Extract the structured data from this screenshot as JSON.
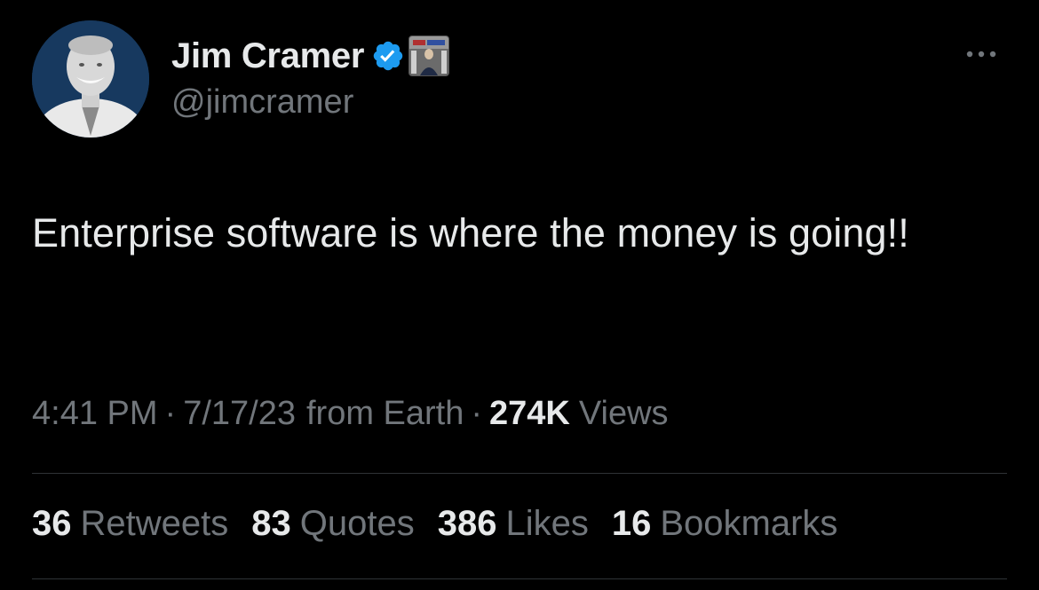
{
  "author": {
    "display_name": "Jim Cramer",
    "handle": "@jimcramer",
    "avatar_icon": "profile-photo",
    "verified_icon": "verified-check-icon",
    "verified_color": "#1d9bf0",
    "affiliate_icon": "affiliate-badge-icon"
  },
  "menu": {
    "more_icon": "more-horizontal-icon"
  },
  "tweet": {
    "text": "Enterprise software is where the money is going!!"
  },
  "meta": {
    "time": "4:41 PM",
    "separator": "·",
    "date": "7/17/23",
    "source": "from Earth",
    "views_count": "274K",
    "views_label": "Views"
  },
  "stats": [
    {
      "count": "36",
      "label": "Retweets"
    },
    {
      "count": "83",
      "label": "Quotes"
    },
    {
      "count": "386",
      "label": "Likes"
    },
    {
      "count": "16",
      "label": "Bookmarks"
    }
  ],
  "colors": {
    "background": "#000000",
    "primary_text": "#e7e9ea",
    "secondary_text": "#71767b",
    "divider": "#2f3336",
    "accent": "#1d9bf0"
  }
}
